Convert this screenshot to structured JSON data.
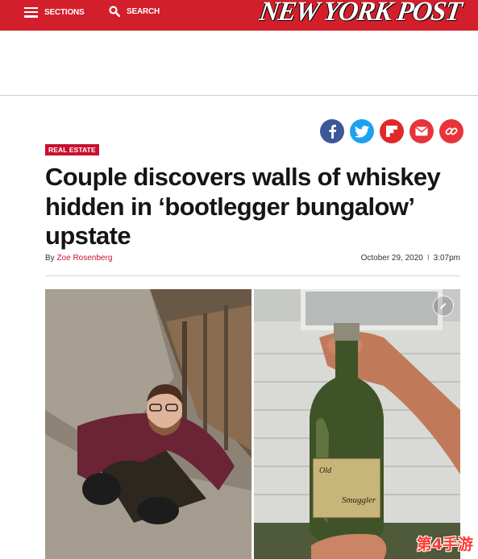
{
  "header": {
    "sections_label": "SECTIONS",
    "search_label": "SEARCH",
    "brand": "NEW YORK POST",
    "brand_color": "#d21f2b"
  },
  "share": {
    "icons": [
      "facebook-icon",
      "twitter-icon",
      "flipboard-icon",
      "email-icon",
      "link-icon"
    ],
    "colors": [
      "#3b5998",
      "#1da1f2",
      "#e12828",
      "#e8333b",
      "#e8333b"
    ]
  },
  "article": {
    "section_tag": "REAL ESTATE",
    "headline": "Couple discovers walls of whiskey hidden in ‘bootlegger bungalow’ upstate",
    "byline_prefix": "By",
    "author": "Zoe Rosenberg",
    "date": "October 29, 2020",
    "time": "3:07pm",
    "date_separator": "I"
  },
  "photo": {
    "bottle_label_brand": "Old",
    "bottle_label_name": "Smuggler"
  },
  "watermark": "第4手游"
}
